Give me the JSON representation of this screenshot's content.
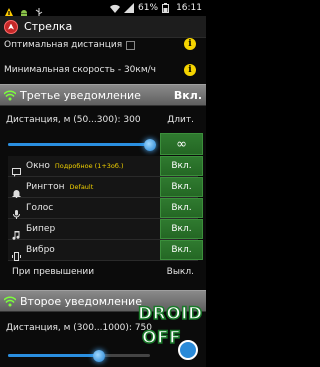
{
  "status_bar": {
    "battery": "61%",
    "time": "16:11",
    "icons": [
      "warning-icon",
      "android-icon",
      "usb-icon",
      "wifi-icon",
      "signal-icon",
      "battery-icon"
    ]
  },
  "action_bar": {
    "title": "Стрелка",
    "app_icon": "arrow-app-icon"
  },
  "settings": {
    "optimal_distance_label": "Оптимальная дистанция",
    "min_speed_label": "Минимальная скорость - 30км/ч"
  },
  "third_notification": {
    "title": "Третье уведомление",
    "state": "Вкл.",
    "distance_label": "Дистанция, м (50...300): 300",
    "duration_label": "Длит.",
    "duration_value": "∞",
    "slider_value": 300,
    "slider_min": 50,
    "slider_max": 300,
    "options": [
      {
        "icon": "chat-icon",
        "label": "Окно",
        "note": "Подробное (1+3об.)",
        "state": "Вкл."
      },
      {
        "icon": "bell-icon",
        "label": "Рингтон",
        "note": "Default",
        "state": "Вкл."
      },
      {
        "icon": "mic-icon",
        "label": "Голос",
        "note": "",
        "state": "Вкл."
      },
      {
        "icon": "music-note-icon",
        "label": "Бипер",
        "note": "",
        "state": "Вкл."
      },
      {
        "icon": "vibrate-icon",
        "label": "Вибро",
        "note": "",
        "state": "Вкл."
      }
    ],
    "on_exceed_label": "При превышении",
    "on_exceed_state": "Выкл."
  },
  "second_notification": {
    "title": "Второе уведомление",
    "distance_label": "Дистанция, м (300...1000): 750",
    "slider_value": 750,
    "slider_min": 300,
    "slider_max": 1000
  },
  "watermark": {
    "line1": "DROID",
    "line2": "OFF"
  },
  "colors": {
    "accent_green": "#2f7a2f",
    "section_gray": "#7a7a7a",
    "slider_blue": "#1f7fd0",
    "note_yellow": "#f0d000"
  }
}
